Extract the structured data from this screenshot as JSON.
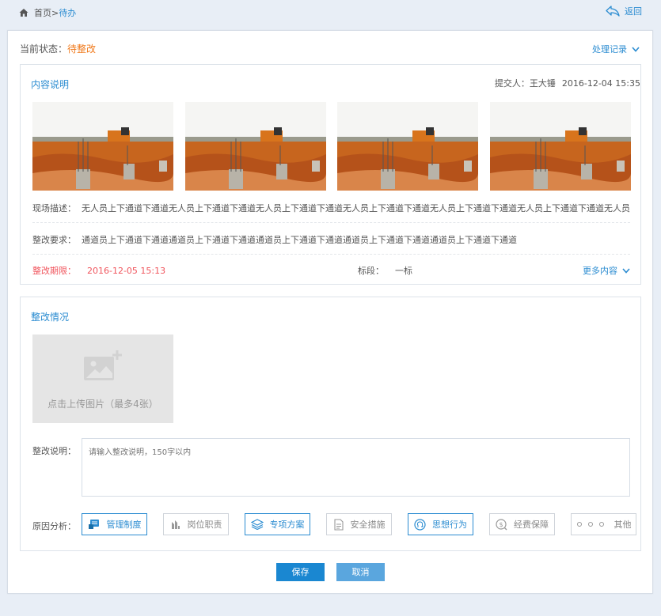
{
  "breadcrumb": {
    "home": "首页",
    "sep": ">",
    "current": "待办"
  },
  "back_label": "返回",
  "status": {
    "label": "当前状态：",
    "value": "待整改"
  },
  "history_label": "处理记录",
  "content": {
    "title": "内容说明",
    "submitter_label": "提交人：",
    "submitter_name": "王大锤",
    "submit_time": "2016-12-04 15:35",
    "scene_label": "现场描述：",
    "scene_text": "无人员上下通道下通道无人员上下通道下通道无人员上下通道下通道无人员上下通道下通道无人员上下通道下通道无人员上下通道下通道无人员上下通道",
    "req_label": "整改要求：",
    "req_text": "通道员上下通道下通道通道员上下通道下通道通道员上下通道下通道通道员上下通道下通道通道员上下通道下通道",
    "deadline_label": "整改期限：",
    "deadline_value": "2016-12-05 15:13",
    "section_label": "标段：",
    "section_value": "一标",
    "more_label": "更多内容"
  },
  "rectify": {
    "title": "整改情况",
    "upload_text": "点击上传图片（最多4张）",
    "desc_label": "整改说明：",
    "desc_placeholder": "请输入整改说明，150字以内",
    "reason_label": "原因分析：",
    "reasons": [
      {
        "label": "管理制度",
        "icon": "management-icon",
        "selected": true
      },
      {
        "label": "岗位职责",
        "icon": "position-icon",
        "selected": false
      },
      {
        "label": "专项方案",
        "icon": "layers-icon",
        "selected": true
      },
      {
        "label": "安全措施",
        "icon": "document-icon",
        "selected": false
      },
      {
        "label": "思想行为",
        "icon": "head-icon",
        "selected": true
      },
      {
        "label": "经费保障",
        "icon": "money-icon",
        "selected": false
      },
      {
        "label": "其他",
        "icon": "more-dots-icon",
        "selected": false
      }
    ]
  },
  "actions": {
    "save": "保存",
    "cancel": "取消"
  },
  "colors": {
    "accent": "#2b8cd1",
    "status": "#f07a1c",
    "deadline": "#f0545c"
  }
}
